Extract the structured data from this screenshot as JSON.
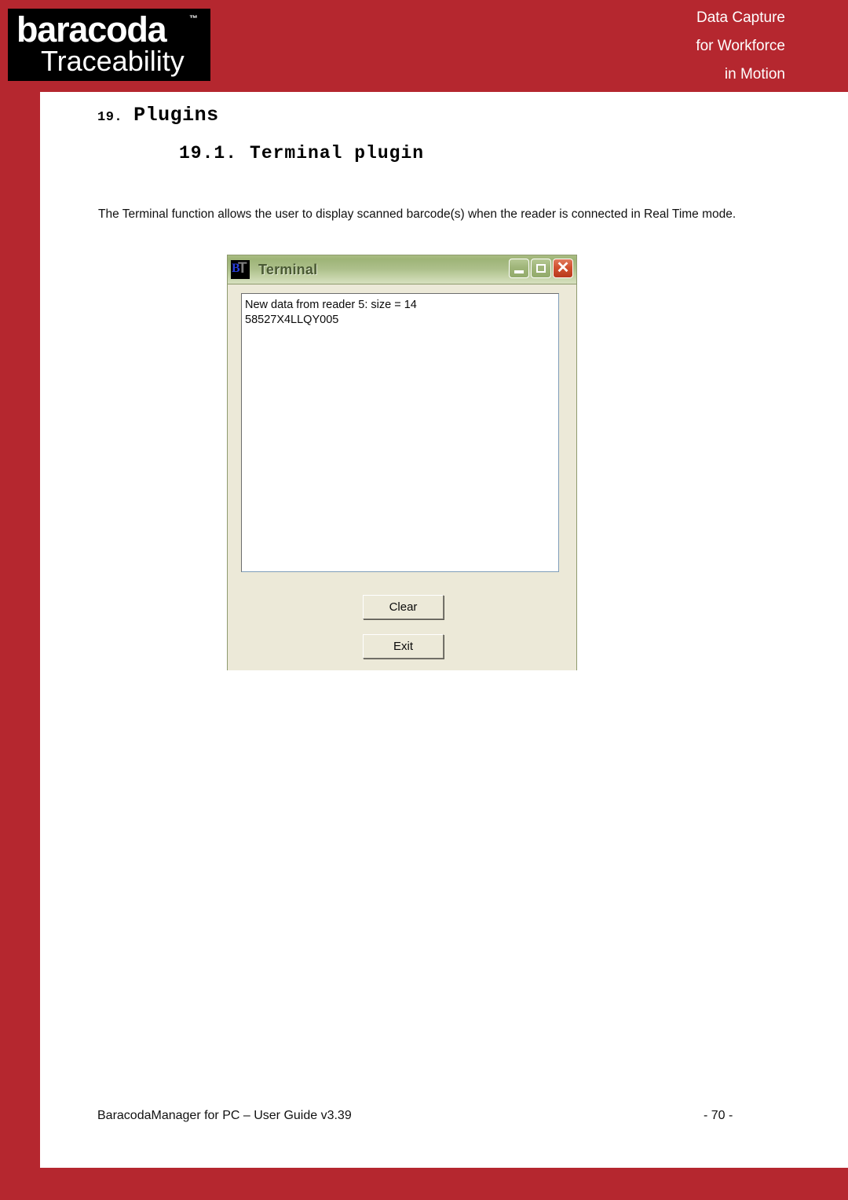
{
  "header": {
    "logo": {
      "main": "baracoda",
      "trademark": "™",
      "sub": "Traceability"
    },
    "tagline": {
      "line1": "Data Capture",
      "line2": "for Workforce",
      "line3": "in Motion"
    },
    "brand_red": "#B5272F"
  },
  "document": {
    "heading1": {
      "number": "19.",
      "text": "Plugins"
    },
    "heading2": {
      "number": "19.1.",
      "text": "Terminal plugin"
    },
    "paragraph": "The Terminal function allows the user to display scanned barcode(s) when the reader is connected in Real Time mode."
  },
  "terminal_window": {
    "icon_name": "bt-terminal-icon",
    "icon_letters": {
      "b": "B",
      "t": "T"
    },
    "title": "Terminal",
    "controls": {
      "minimize": "minimize-button",
      "maximize": "maximize-button",
      "close": "close-button",
      "close_glyph": "✕"
    },
    "output_lines": [
      "New data from reader 5: size = 14",
      "58527X4LLQY005"
    ],
    "buttons": {
      "clear": "Clear",
      "exit": "Exit"
    },
    "titlebar_color": "#9EB477",
    "body_color": "#ECE9D8"
  },
  "footer": {
    "left": "BaracodaManager for PC – User Guide v3.39",
    "right": "- 70 -"
  }
}
